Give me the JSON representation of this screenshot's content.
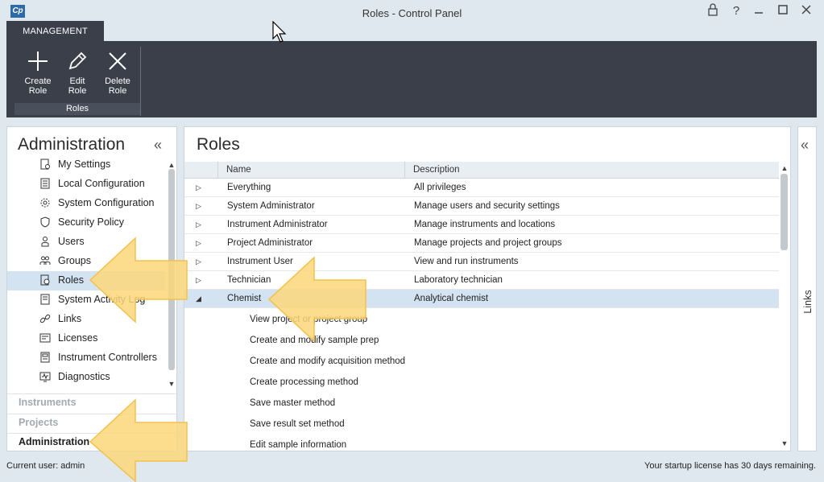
{
  "window": {
    "title": "Roles - Control Panel",
    "app_icon": "Cp",
    "controls": [
      "lock-icon",
      "help-icon",
      "minimize-icon",
      "maximize-icon",
      "close-icon"
    ]
  },
  "ribbon": {
    "tab": "MANAGEMENT",
    "buttons": [
      {
        "label1": "Create",
        "label2": "Role",
        "icon": "plus-icon"
      },
      {
        "label1": "Edit",
        "label2": "Role",
        "icon": "pencil-icon"
      },
      {
        "label1": "Delete",
        "label2": "Role",
        "icon": "x-icon"
      }
    ],
    "group_label": "Roles"
  },
  "sidebar": {
    "title": "Administration",
    "items": [
      {
        "label": "My Settings",
        "icon": "settings-doc-icon"
      },
      {
        "label": "Local Configuration",
        "icon": "local-config-icon"
      },
      {
        "label": "System Configuration",
        "icon": "gear-icon"
      },
      {
        "label": "Security Policy",
        "icon": "shield-icon"
      },
      {
        "label": "Users",
        "icon": "user-icon"
      },
      {
        "label": "Groups",
        "icon": "group-icon"
      },
      {
        "label": "Roles",
        "icon": "role-icon"
      },
      {
        "label": "System Activity Log",
        "icon": "log-icon"
      },
      {
        "label": "Links",
        "icon": "link-icon"
      },
      {
        "label": "Licenses",
        "icon": "license-icon"
      },
      {
        "label": "Instrument Controllers",
        "icon": "controller-icon"
      },
      {
        "label": "Diagnostics",
        "icon": "diagnostics-icon"
      }
    ],
    "selected": "Roles",
    "sections": [
      "Instruments",
      "Projects",
      "Administration"
    ]
  },
  "main": {
    "title": "Roles",
    "columns": [
      "Name",
      "Description"
    ],
    "rows": [
      {
        "name": "Everything",
        "description": "All privileges",
        "expanded": false
      },
      {
        "name": "System Administrator",
        "description": "Manage users and security settings",
        "expanded": false
      },
      {
        "name": "Instrument Administrator",
        "description": "Manage instruments and locations",
        "expanded": false
      },
      {
        "name": "Project Administrator",
        "description": "Manage projects and project groups",
        "expanded": false
      },
      {
        "name": "Instrument User",
        "description": "View and run instruments",
        "expanded": false
      },
      {
        "name": "Technician",
        "description": "Laboratory technician",
        "expanded": false
      },
      {
        "name": "Chemist",
        "description": "Analytical chemist",
        "expanded": true
      }
    ],
    "privileges": [
      "View project or project group",
      "Create and modify sample prep",
      "Create and modify acquisition method",
      "Create processing method",
      "Save master method",
      "Save result set method",
      "Edit sample information"
    ]
  },
  "links_panel": {
    "label": "Links"
  },
  "status": {
    "left": "Current user: admin",
    "right": "Your startup license has 30 days remaining."
  },
  "colors": {
    "ribbon": "#3a3f4a",
    "selection": "#d3e3f1",
    "highlight_arrow": "#fbd77a"
  }
}
